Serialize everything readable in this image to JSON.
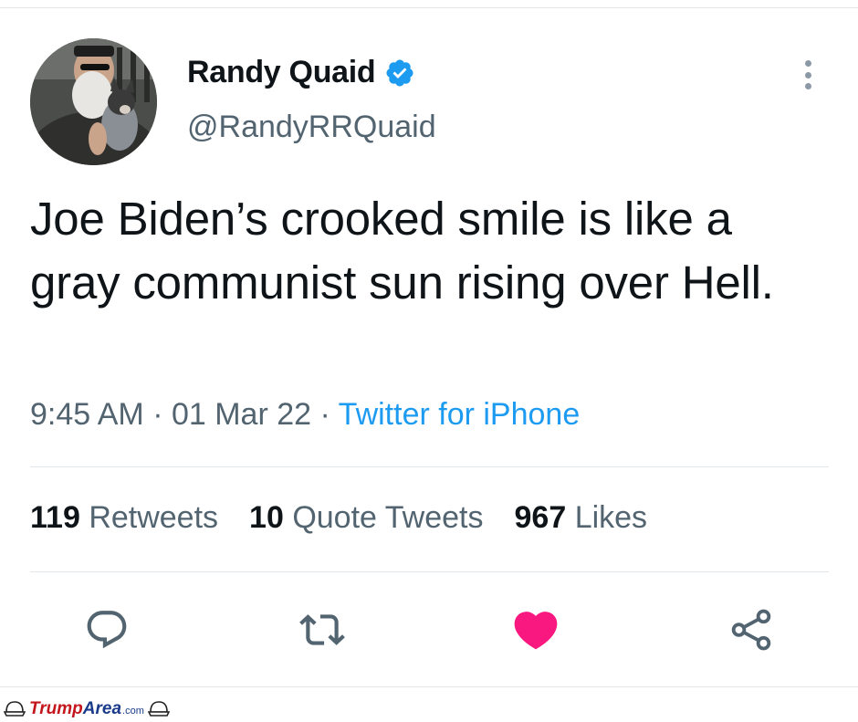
{
  "tweet": {
    "author": {
      "display_name": "Randy Quaid",
      "handle": "@RandyRRQuaid",
      "verified": true,
      "avatar_icon": "avatar-photo"
    },
    "text": "Joe Biden’s crooked smile is like a gray communist sun rising over Hell.",
    "meta": {
      "time": "9:45 AM",
      "separator": " · ",
      "date": "01 Mar 22",
      "source": "Twitter for iPhone"
    },
    "stats": [
      {
        "count": "119",
        "label": "Retweets"
      },
      {
        "count": "10",
        "label": "Quote Tweets"
      },
      {
        "count": "967",
        "label": "Likes"
      }
    ],
    "actions": [
      {
        "icon": "reply-icon"
      },
      {
        "icon": "retweet-icon"
      },
      {
        "icon": "like-icon",
        "active": true
      },
      {
        "icon": "share-icon"
      }
    ]
  },
  "watermark": {
    "brand_primary": "Trump",
    "brand_secondary": "Area",
    "suffix": ".com"
  },
  "colors": {
    "verified": "#1d9bf0",
    "link": "#1d9bf0",
    "like": "#f91880",
    "muted": "#536471",
    "text": "#0f1419"
  }
}
